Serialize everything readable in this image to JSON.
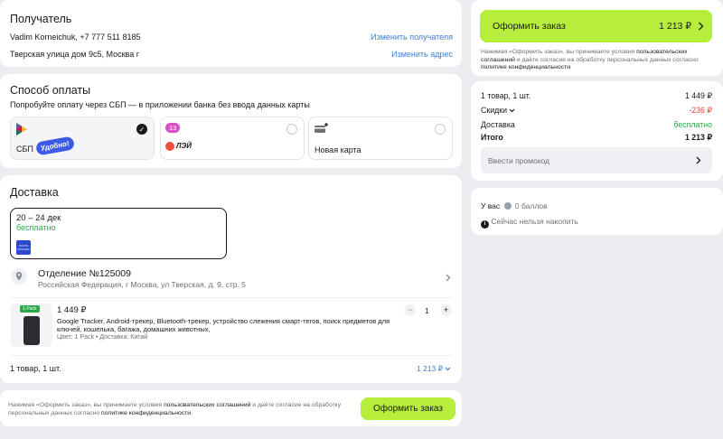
{
  "recipient": {
    "title": "Получатель",
    "name_phone": "Vadim Korneichuk, +7 777 511 8185",
    "change_recipient": "Изменить получателя",
    "address": "Тверская улица дом 9с5, Москва г",
    "change_address": "Изменить адрес"
  },
  "payment": {
    "title": "Способ оплаты",
    "hint": "Попробуйте оплату через СБП — в приложении банка без ввода данных карты",
    "sbp_label": "СБП",
    "sbp_badge": "Удобно!",
    "split_badge": "13",
    "split_label": "ЛЭЙ",
    "new_card_label": "Новая карта",
    "check_mark": "✓"
  },
  "delivery": {
    "title": "Доставка",
    "dates": "20 – 24 дек",
    "price": "бесплатно",
    "carrier_logo": "ПОЧТА РОССИИ",
    "office_title": "Отделение №125009",
    "office_address": "Российская Федерация, г Москва, ул Тверская, д. 9, стр. 5",
    "product_badge": "1-Pack",
    "product_price": "1 449 ₽",
    "product_desc": "Google Tracker, Android-трекер, Bluetooth-трекер, устройство слежения смарт-тегов, поиск предметов для ключей, кошелька, багажа, домашних животных,",
    "product_meta": "Цвет: 1 Pack • Доставка: Китай",
    "qty": "1",
    "minus": "−",
    "plus": "+",
    "summary_count": "1 товар, 1 шт.",
    "summary_total": "1 213 ₽"
  },
  "footer": {
    "legal_pre": "Нажимая «Оформить заказ», вы принимаете условия ",
    "legal_link1": "пользовательских соглашений",
    "legal_mid": " и даёте согласие на обработку персональных данных согласно ",
    "legal_link2": "политике конфиденциальности",
    "legal_end": ".",
    "order_button": "Оформить заказ"
  },
  "sidebar": {
    "order_button": "Оформить заказ",
    "order_total": "1 213 ₽",
    "legal_pre": "Нажимая «Оформить заказ», вы принимаете условия ",
    "legal_link1": "пользовательских соглашений",
    "legal_mid": " и даёте согласие на обработку персональных данных согласно ",
    "legal_link2": "политике конфиденциальности",
    "legal_end": "",
    "items_label": "1 товар, 1 шт.",
    "items_value": "1 449 ₽",
    "discounts_label": "Скидки",
    "discounts_value": "-236 ₽",
    "shipping_label": "Доставка",
    "shipping_value": "бесплатно",
    "total_label": "Итого",
    "total_value": "1 213 ₽",
    "promo_placeholder": "Ввести промокод",
    "points_pre": "У вас",
    "points_value": "0 баллов",
    "points_note": "Сейчас нельзя накопить"
  },
  "colors": {
    "accent": "#b6ee3c",
    "link": "#3f7fd8",
    "success": "#2aa84a",
    "discount": "#e0453a"
  }
}
